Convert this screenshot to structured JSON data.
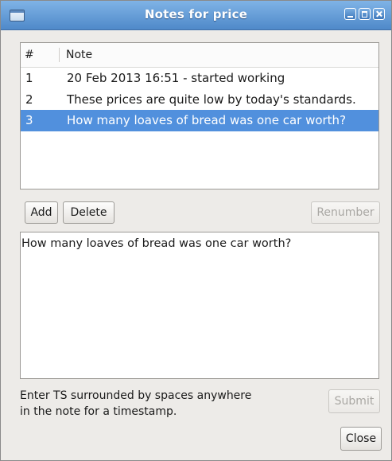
{
  "window": {
    "title": "Notes for price"
  },
  "notes_table": {
    "columns": [
      "#",
      "Note"
    ],
    "rows": [
      {
        "num": "1",
        "note": "20 Feb 2013 16:51 - started working"
      },
      {
        "num": "2",
        "note": "These prices are quite low by today's standards."
      },
      {
        "num": "3",
        "note": "How many loaves of bread was one car worth?"
      }
    ],
    "selected_row": 3
  },
  "buttons": {
    "add": "Add",
    "delete": "Delete",
    "renumber": "Renumber",
    "submit": "Submit",
    "close": "Close"
  },
  "editor": {
    "value": "How many loaves of bread was one car worth?"
  },
  "hint": {
    "line1": "Enter TS surrounded by spaces anywhere",
    "line2": "in the note for a timestamp."
  },
  "colors": {
    "titlebar": "#5b93d3",
    "selection": "#5190dd",
    "window_bg": "#edebe8"
  }
}
